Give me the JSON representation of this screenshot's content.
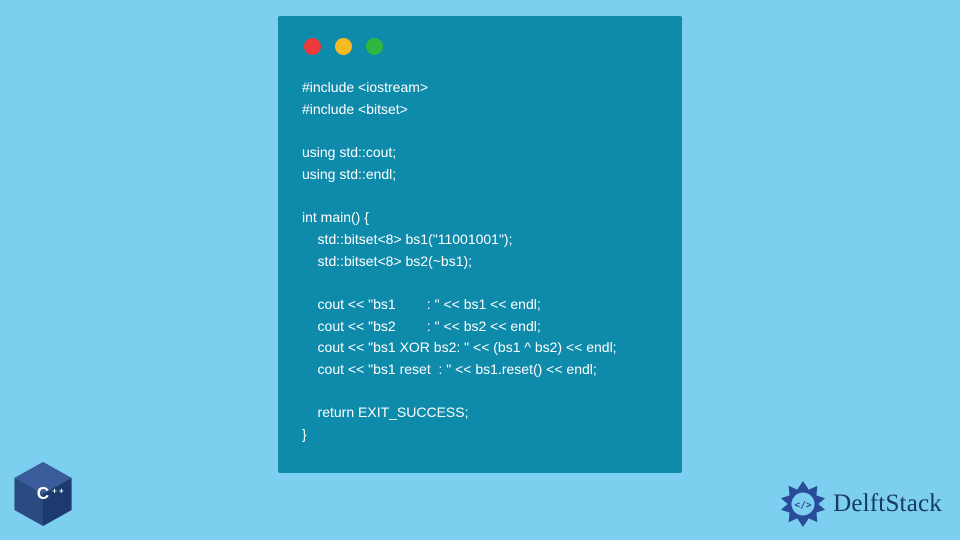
{
  "window": {
    "dots": [
      "red",
      "yellow",
      "green"
    ]
  },
  "code": {
    "lines": [
      "#include <iostream>",
      "#include <bitset>",
      "",
      "using std::cout;",
      "using std::endl;",
      "",
      "int main() {",
      "    std::bitset<8> bs1(\"11001001\");",
      "    std::bitset<8> bs2(~bs1);",
      "",
      "    cout << \"bs1        : \" << bs1 << endl;",
      "    cout << \"bs2        : \" << bs2 << endl;",
      "    cout << \"bs1 XOR bs2: \" << (bs1 ^ bs2) << endl;",
      "    cout << \"bs1 reset  : \" << bs1.reset() << endl;",
      "",
      "    return EXIT_SUCCESS;",
      "}"
    ]
  },
  "brand": {
    "name": "DelftStack"
  },
  "badge": {
    "label": "C++"
  }
}
